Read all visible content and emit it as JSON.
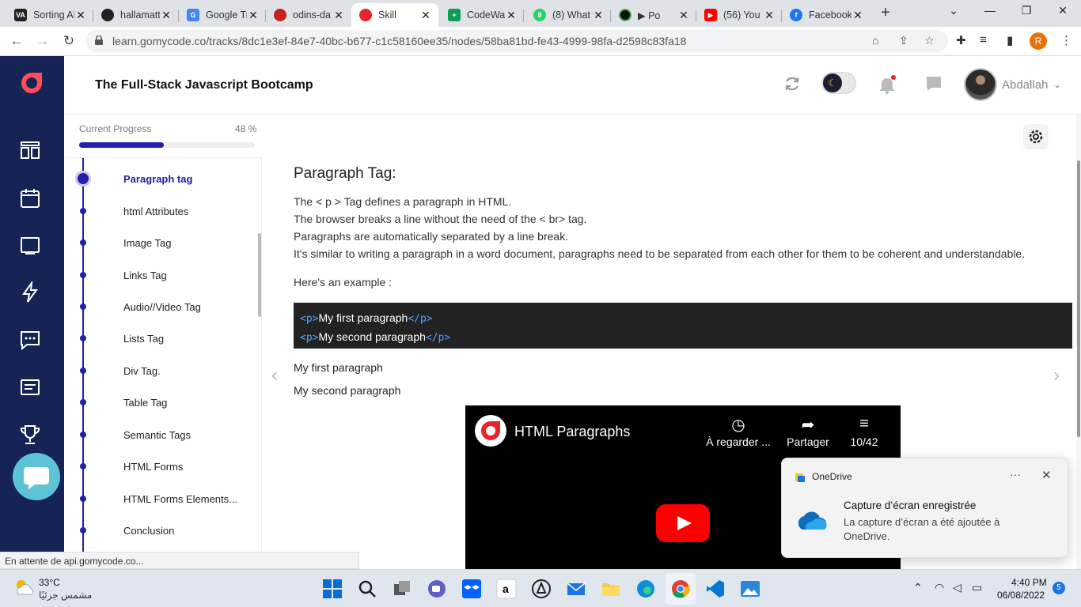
{
  "browser": {
    "tabs": [
      {
        "label": "Sorting Alg",
        "color": "#222"
      },
      {
        "label": "hallamatt/",
        "color": "#222"
      },
      {
        "label": "Google Tra",
        "color": "#4285f4"
      },
      {
        "label": "odins-da",
        "color": "#c5221f"
      },
      {
        "label": "Skill",
        "color": "#e8232e"
      },
      {
        "label": "CodeWars",
        "color": "#0f9d58"
      },
      {
        "label": "(8) What",
        "color": "#25d366"
      },
      {
        "label": "▶ Po",
        "color": "#111"
      },
      {
        "label": "(56) You",
        "color": "#ff0000"
      },
      {
        "label": "Facebook",
        "color": "#1877f2"
      }
    ],
    "new_tab": "+",
    "url": "learn.gomycode.co/tracks/8dc1e3ef-84e7-40bc-b677-c1c58160ee35/nodes/58ba81bd-fe43-4999-98fa-d2598c83fa18",
    "profile_initial": "R",
    "status_text": "En attente de api.gomycode.co..."
  },
  "header": {
    "course_title": "The Full-Stack Javascript Bootcamp",
    "username": "Abdallah"
  },
  "progress": {
    "label": "Current Progress",
    "percent_text": "48 %",
    "fraction": 0.48
  },
  "toc": {
    "items": [
      {
        "label": "Paragraph tag",
        "active": true
      },
      {
        "label": "html Attributes",
        "active": false
      },
      {
        "label": "Image Tag",
        "active": false
      },
      {
        "label": "Links Tag",
        "active": false
      },
      {
        "label": "Audio//Video Tag",
        "active": false
      },
      {
        "label": "Lists Tag",
        "active": false
      },
      {
        "label": "Div Tag.",
        "active": false
      },
      {
        "label": "Table Tag",
        "active": false
      },
      {
        "label": "Semantic Tags",
        "active": false
      },
      {
        "label": "HTML Forms",
        "active": false
      },
      {
        "label": "HTML Forms Elements...",
        "active": false
      },
      {
        "label": "Conclusion",
        "active": false
      }
    ]
  },
  "lesson": {
    "title": "Paragraph Tag:",
    "paragraphs": [
      "The < p > Tag defines a paragraph in HTML.",
      "The browser breaks a line without the need of the < br> tag.",
      "Paragraphs are automatically separated by a line break.",
      "It's similar to writing a paragraph in a word document, paragraphs need to be separated from each other for them to be coherent and understandable."
    ],
    "example_intro": "Here's an example :",
    "code": [
      {
        "open": "<p>",
        "text": "My first paragraph",
        "close": "</p>"
      },
      {
        "open": "<p>",
        "text": "My second paragraph",
        "close": "</p>"
      }
    ],
    "rendered": [
      "My first paragraph",
      "My second paragraph"
    ]
  },
  "video": {
    "title": "HTML Paragraphs",
    "watch_later": "À regarder ...",
    "share": "Partager",
    "playlist": "10/42"
  },
  "toast": {
    "app": "OneDrive",
    "title": "Capture d’écran enregistrée",
    "body": "La capture d’écran a été ajoutée à OneDrive.",
    "more": "···",
    "close": "✕"
  },
  "taskbar": {
    "temperature": "33°C",
    "weather": "مشمس جزئيًا",
    "time": "4:40 PM",
    "date": "06/08/2022",
    "notifications": "5"
  },
  "colors": {
    "nav_bg": "#162455",
    "accent": "#2221a8",
    "brand_red": "#e8232e"
  }
}
